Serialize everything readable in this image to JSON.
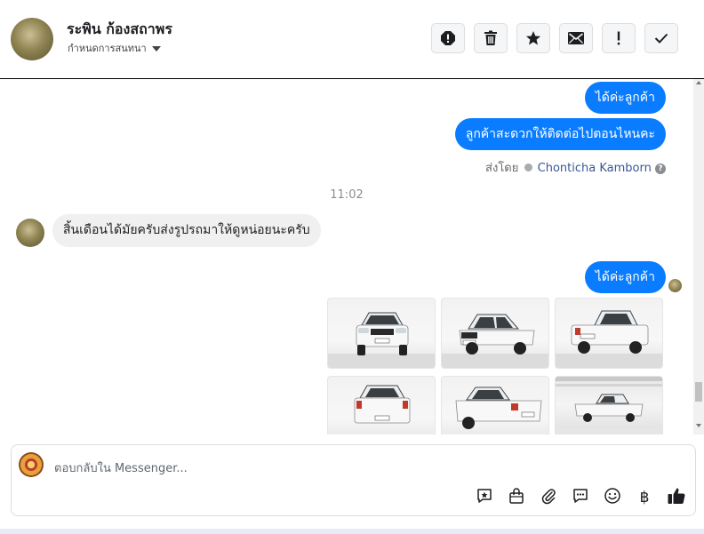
{
  "header": {
    "contact_name": "ระพิน ก้องสถาพร",
    "assign_label": "กำหนดการสนทนา",
    "actions": [
      "spam-icon",
      "trash-icon",
      "star-icon",
      "mail-icon",
      "exclamation-icon",
      "check-icon"
    ]
  },
  "messages": {
    "out_1": "ได้ค่ะลูกค้า",
    "out_2": "ลูกค้าสะดวกให้ติดต่อไปตอนไหนคะ",
    "sent_by_label": "ส่งโดย",
    "sent_by_name": "Chonticha Kamborn",
    "help_glyph": "?",
    "timestamp": "11:02",
    "in_1": "สิ้นเดือนได้มัยครับส่งรูปรถมาให้ดูหน่อยนะครับ",
    "out_3": "ได้ค่ะลูกค้า"
  },
  "composer": {
    "placeholder": "ตอบกลับใน Messenger...",
    "tools": [
      "saved-reply-icon",
      "shopping-bag-icon",
      "attach-icon",
      "chat-bubble-icon",
      "emoji-icon",
      "baht-icon",
      "like-icon"
    ],
    "baht_glyph": "฿"
  },
  "colors": {
    "outgoing_bubble": "#0a7cff",
    "incoming_bubble": "#f0f0f0",
    "sender_name": "#385898"
  }
}
